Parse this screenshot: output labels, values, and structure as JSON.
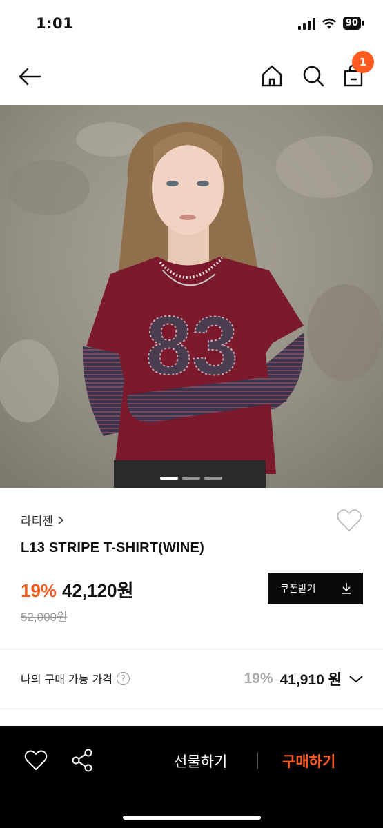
{
  "status_bar": {
    "time": "1:01",
    "battery": "90"
  },
  "header": {
    "back_icon": "arrow-left-icon",
    "home_icon": "home-icon",
    "search_icon": "search-icon",
    "bag_icon": "shopping-bag-icon",
    "cart_count": "1"
  },
  "product": {
    "image_alt": "product-photo",
    "image_indicator_count": 3,
    "brand": "라티젠",
    "name": "L13 STRIPE T-SHIRT(WINE)",
    "discount": "19%",
    "price": "42,120원",
    "original_price": "52,000원",
    "coupon_label": "쿠폰받기"
  },
  "my_price": {
    "label": "나의 구매 가능 가격",
    "discount": "19%",
    "price": "41,910 원"
  },
  "bottom_bar": {
    "gift_label": "선물하기",
    "buy_label": "구매하기"
  },
  "colors": {
    "accent": "#f05a1e",
    "badge": "#ff5a1f",
    "dark": "#0a0a0a"
  }
}
